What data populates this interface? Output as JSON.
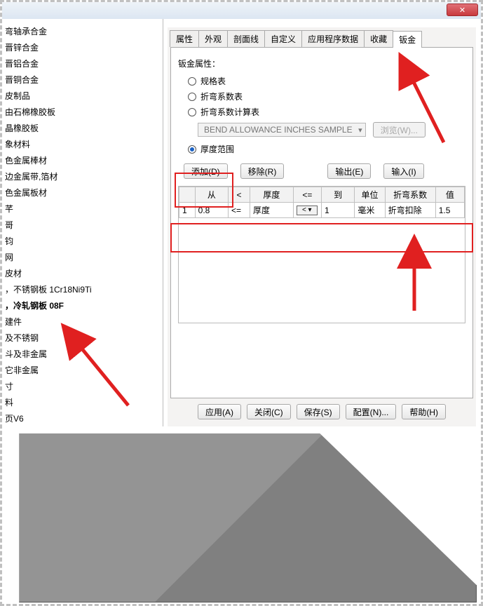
{
  "titlebar": {
    "close": "✕"
  },
  "sidebar": {
    "items": [
      "弯轴承合金",
      "晋锌合金",
      "晋铝合金",
      "晋铜合金",
      "皮制品",
      "由石棉橡胶板",
      "晶橡胶板",
      "象材料",
      "色金属棒材",
      "边金属带,箔材",
      "色金属板材",
      "芊",
      "哥",
      "钧",
      "网",
      "皮材",
      "，不锈钢板 1Cr18Ni9Ti",
      "，冷轧钢板 08F",
      "建件",
      "及不锈钢",
      "斗及非金属",
      "它非金属",
      "寸",
      "料",
      "页V6"
    ],
    "bold_index": 17
  },
  "tabs": [
    "属性",
    "外观",
    "剖面线",
    "自定义",
    "应用程序数据",
    "收藏",
    "钣金"
  ],
  "active_tab": "钣金",
  "panel": {
    "label": "钣金属性：",
    "radios": {
      "option1": "规格表",
      "option2": "折弯系数表",
      "option3": "折弯系数计算表",
      "option4": "厚度范围"
    },
    "checked_radio": "option4",
    "dropdown_value": "BEND ALLOWANCE INCHES SAMPLE",
    "browse": "浏览(W)...",
    "buttons": {
      "add": "添加(D)",
      "remove": "移除(R)",
      "export": "输出(E)",
      "import": "输入(I)"
    },
    "table": {
      "headers": [
        "",
        "从",
        "<",
        "厚度",
        "<=",
        "到",
        "单位",
        "折弯系数",
        "值"
      ],
      "row": {
        "idx": "1",
        "from": "0.8",
        "op1": "<=",
        "thick": "厚度",
        "op_sel": "< ▾",
        "to": "1",
        "unit": "毫米",
        "coef": "折弯扣除",
        "val": "1.5"
      }
    }
  },
  "bottom_buttons": [
    "应用(A)",
    "关闭(C)",
    "保存(S)",
    "配置(N)...",
    "帮助(H)"
  ]
}
